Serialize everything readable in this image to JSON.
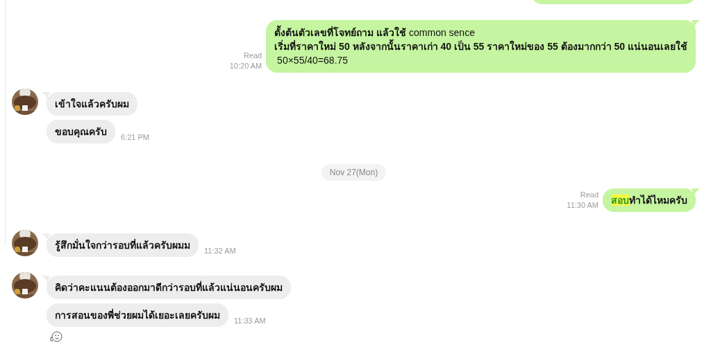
{
  "messages": [
    {
      "kind": "outgoing",
      "read": "Read",
      "time": "10:20 AM",
      "lines": [
        "**ตั้งต้นตัวเลขที่โจทย์ถาม แล้วใช้** common sence",
        "**เริ่มที่ราคาใหม่ 50 หลังจากนั้นราคาเก่า 40 เป็น 55 ราคาใหม่ของ 55 ต้องมากกว่า 50 แน่นอนเลยใช้**",
        " 50×55/40=68.75"
      ]
    },
    {
      "kind": "incoming",
      "bubbles": [
        {
          "text": "เข้าใจแล้วครับผม"
        },
        {
          "text": "ขอบคุณครับ",
          "time": "6:21 PM"
        }
      ]
    },
    {
      "kind": "date",
      "label": "Nov 27(Mon)"
    },
    {
      "kind": "outgoing_segments",
      "read": "Read",
      "time": "11:30 AM",
      "segments": [
        {
          "text": "สอบ",
          "highlighted": true
        },
        {
          "text": "ทำได้ไหมครับ",
          "highlighted": false
        }
      ]
    },
    {
      "kind": "incoming",
      "bubbles": [
        {
          "text": "รู้สึกมั่นใจกว่ารอบที่แล้วครับผมม",
          "time": "11:32 AM"
        }
      ]
    },
    {
      "kind": "incoming",
      "bubbles": [
        {
          "text": "คิดว่าคะแนนต้องออกมาดีกว่ารอบที่แล้วแน่นอนครับผม"
        },
        {
          "text": "การสอนของพี่ช่วยผมได้เยอะเลยครับผม",
          "time": "11:33 AM"
        }
      ],
      "sticker": true
    }
  ]
}
